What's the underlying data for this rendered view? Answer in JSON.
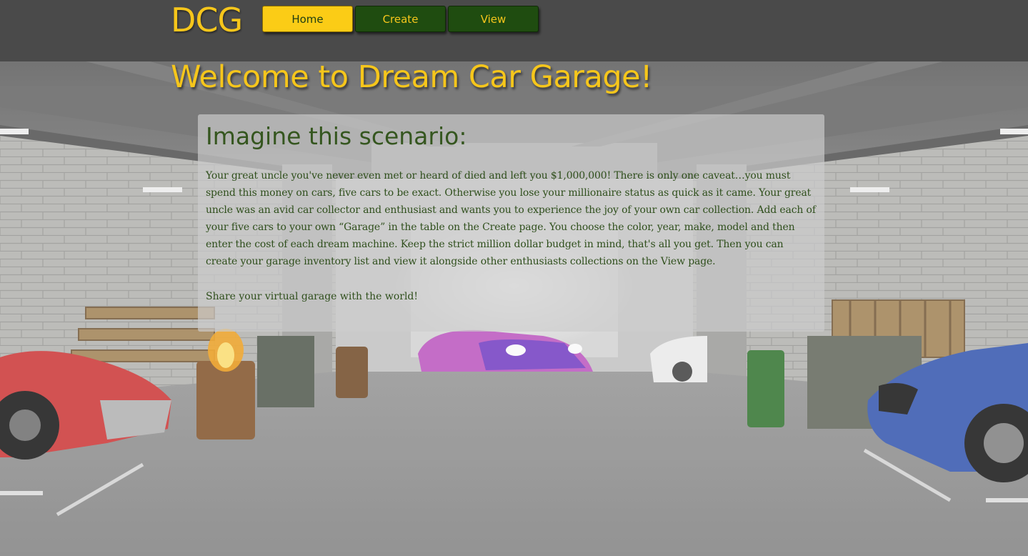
{
  "header": {
    "logo": "DCG",
    "nav": [
      {
        "label": "Home",
        "active": true
      },
      {
        "label": "Create",
        "active": false
      },
      {
        "label": "View",
        "active": false
      }
    ]
  },
  "main": {
    "title": "Welcome to Dream Car Garage!",
    "panel": {
      "heading": "Imagine this scenario:",
      "body": "Your great uncle you've never even met or heard of died and left you $1,000,000! There is only one caveat…you must spend this money on cars, five cars to be exact. Otherwise you lose your millionaire status as quick as it came. Your great uncle was an avid car collector and enthusiast and wants you to experience the joy of your own car collection. Add each of your five cars to your own “Garage” in the table on the Create page. You choose the color, year, make, model and then enter the cost of each dream machine. Keep the strict million dollar budget in mind, that's all you get. Then you can create your garage inventory list and view it alongside other enthusiasts collections on the View page.",
      "share": "Share your virtual garage with the world!"
    }
  },
  "colors": {
    "topbar": "#4a4a4a",
    "accent_yellow": "#f6c61b",
    "nav_green": "#1f4c10",
    "text_green": "#2f4f1c"
  },
  "background": {
    "image": "underground garage with parked sports cars"
  }
}
